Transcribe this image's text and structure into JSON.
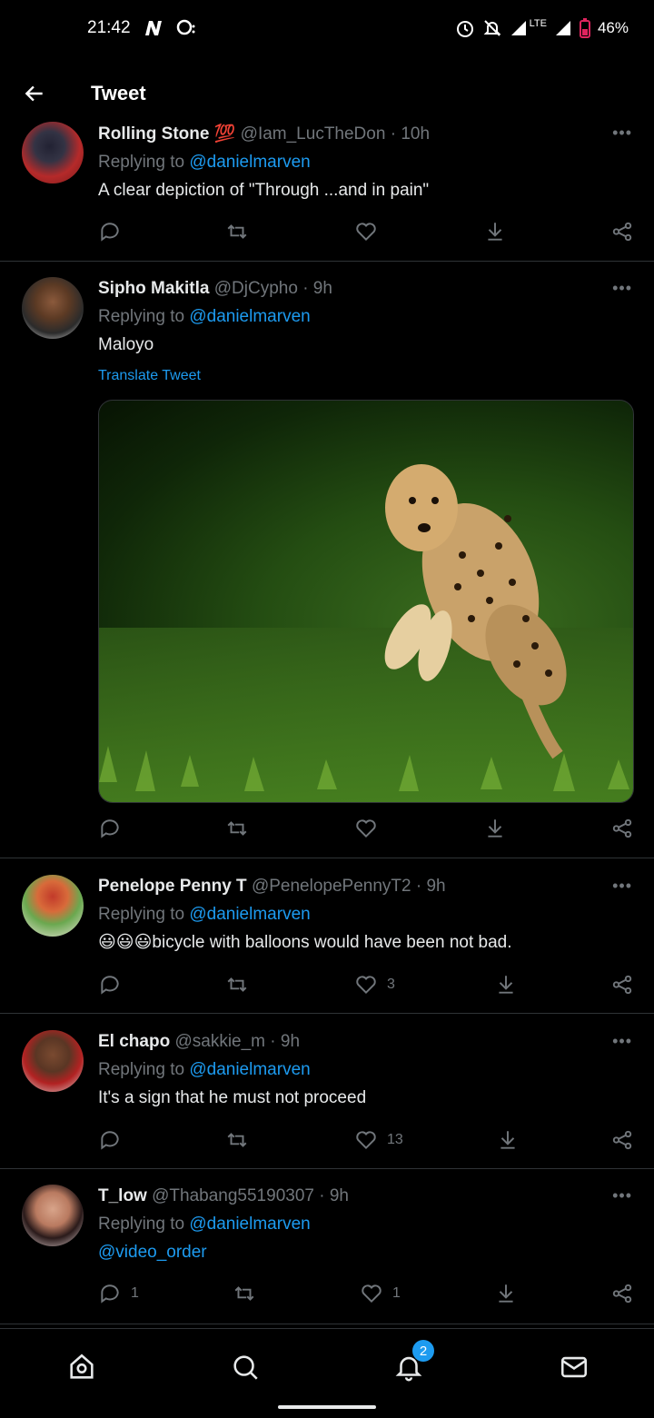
{
  "status": {
    "time": "21:42",
    "lte": "LTE",
    "battery": "46%"
  },
  "header": {
    "title": "Tweet"
  },
  "tweets": [
    {
      "name": "Rolling Stone",
      "handle": "@Iam_LucTheDon",
      "time": "10h",
      "replying_label": "Replying to",
      "mention": "@danielmarven",
      "text": "A clear depiction of \"Through ...and in pain\"",
      "counts": {
        "reply": "",
        "retweet": "",
        "like": ""
      }
    },
    {
      "name": "Sipho Makitla",
      "handle": "@DjCypho",
      "time": "9h",
      "replying_label": "Replying to",
      "mention": "@danielmarven",
      "text": "Maloyo",
      "translate": "Translate Tweet",
      "counts": {
        "reply": "",
        "retweet": "",
        "like": ""
      }
    },
    {
      "name": "Penelope Penny T",
      "handle": "@PenelopePennyT2",
      "time": "9h",
      "replying_label": "Replying to",
      "mention": "@danielmarven",
      "text": "😃😃😃bicycle with balloons would have been not bad.",
      "counts": {
        "reply": "",
        "retweet": "",
        "like": "3"
      }
    },
    {
      "name": "El chapo",
      "handle": "@sakkie_m",
      "time": "9h",
      "replying_label": "Replying to",
      "mention": "@danielmarven",
      "text": "It's a sign that he must not proceed",
      "counts": {
        "reply": "",
        "retweet": "",
        "like": "13"
      }
    },
    {
      "name": "T_low",
      "handle": "@Thabang55190307",
      "time": "9h",
      "replying_label": "Replying to",
      "mention": "@danielmarven",
      "text": "@video_order",
      "counts": {
        "reply": "1",
        "retweet": "",
        "like": "1"
      }
    }
  ],
  "nav": {
    "notifications_badge": "2"
  },
  "icons": [
    "back-arrow-icon",
    "home-icon",
    "search-icon",
    "bell-icon",
    "mail-icon",
    "reply-icon",
    "retweet-icon",
    "heart-icon",
    "download-icon",
    "share-icon",
    "more-icon"
  ]
}
